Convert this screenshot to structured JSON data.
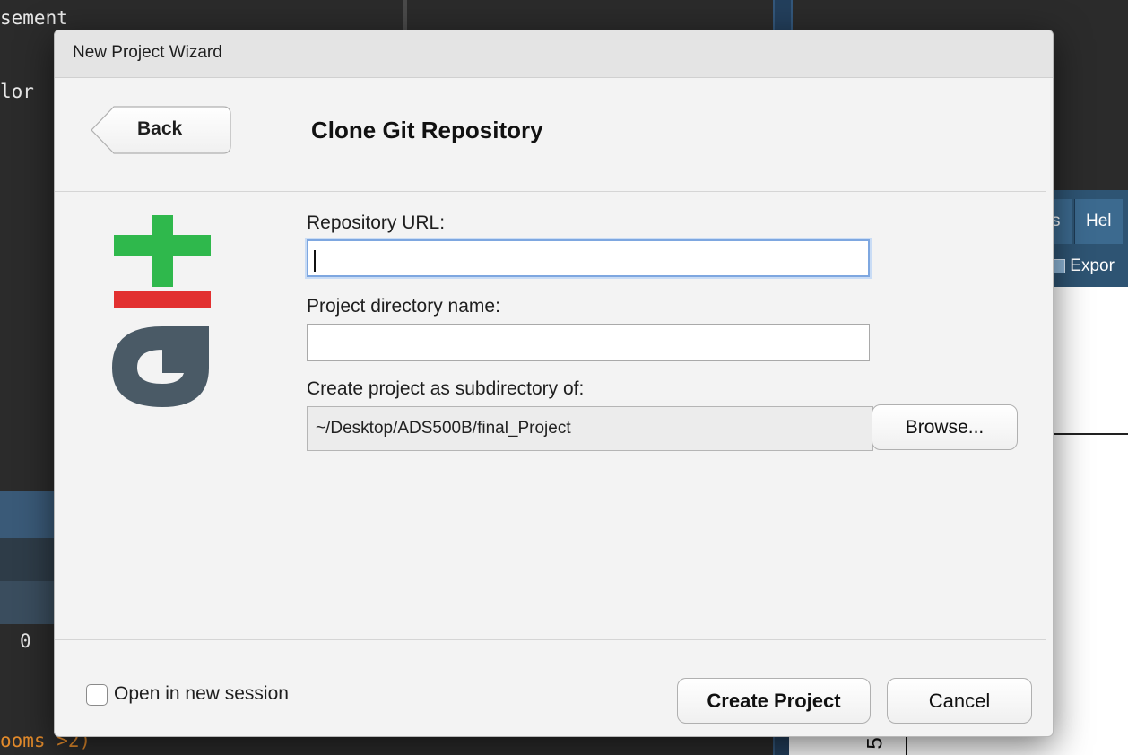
{
  "background": {
    "code_lines": [
      "sement",
      "lor"
    ],
    "left_value": "0",
    "bottom_code": "ooms >2)",
    "right_tabs": [
      "s",
      "Hel"
    ],
    "right_toolbar": "Expor",
    "bottom_glyph": "5"
  },
  "dialog": {
    "title": "New Project Wizard",
    "back_label": "Back",
    "heading": "Clone Git Repository",
    "repo_url_label": "Repository URL:",
    "repo_url_value": "",
    "project_dir_label": "Project directory name:",
    "project_dir_value": "",
    "subdir_label": "Create project as subdirectory of:",
    "subdir_value": "~/Desktop/ADS500B/final_Project",
    "browse_label": "Browse...",
    "new_session_label": "Open in new session",
    "new_session_checked": false,
    "create_label": "Create Project",
    "cancel_label": "Cancel"
  },
  "icons": {
    "logo": "git-logo-icon",
    "checkbox": "checkbox-icon"
  },
  "colors": {
    "git_plus": "#2fb84c",
    "git_minus": "#e23030",
    "git_g": "#4a5a66",
    "focus_ring": "#7ea7e0"
  }
}
